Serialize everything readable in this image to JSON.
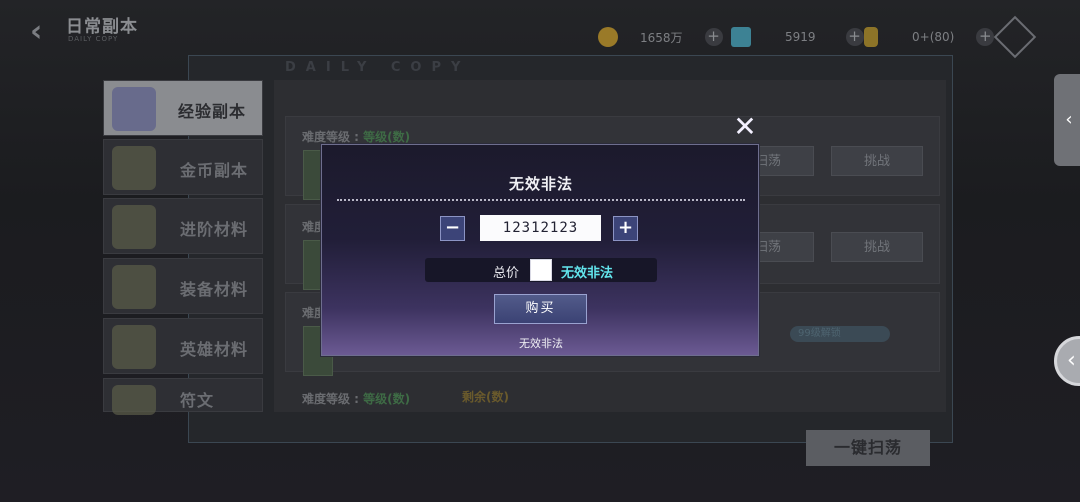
{
  "header": {
    "title": "日常副本",
    "subtitle": "DAILY COPY",
    "resources": [
      {
        "name": "gold",
        "value": "1658万",
        "color": "#b38a2a"
      },
      {
        "name": "diamond",
        "value": "5919",
        "color": "#3aa0b8"
      },
      {
        "name": "stamina",
        "value": "0+(80)",
        "color": "#b3922a"
      }
    ]
  },
  "panel": {
    "heading": "DAILY COPY",
    "rows": [
      {
        "label_prefix": "难度等级 : ",
        "label_value": "等级(数)",
        "sweep": "扫荡",
        "challenge": "挑战"
      },
      {
        "label_prefix": "难度",
        "label_value": "",
        "sweep": "扫荡",
        "challenge": "挑战"
      },
      {
        "label_prefix": "难度",
        "label_value": "",
        "pill": "99级解锁"
      },
      {
        "label_prefix": "难度等级 : ",
        "label_value": "等级(数)",
        "extra": "剩余(数)"
      }
    ],
    "bulk_sweep": "一键扫荡"
  },
  "sidebar": {
    "items": [
      {
        "label": "经验副本",
        "active": true
      },
      {
        "label": "金币副本",
        "active": false
      },
      {
        "label": "进阶材料",
        "active": false
      },
      {
        "label": "装备材料",
        "active": false
      },
      {
        "label": "英雄材料",
        "active": false
      },
      {
        "label": "符文",
        "active": false
      }
    ]
  },
  "modal": {
    "title": "无效非法",
    "quantity": "12312123",
    "minus": "−",
    "plus": "+",
    "total_label": "总价",
    "total_value": "无效非法",
    "buy_label": "购买",
    "note": "无效非法",
    "close": "✕"
  },
  "right_tab": "‹",
  "right_orb": "‹",
  "colors": {
    "accent": "#62e4ec",
    "modal_bg": "#211e38",
    "buy_btn": "#3b4274"
  }
}
